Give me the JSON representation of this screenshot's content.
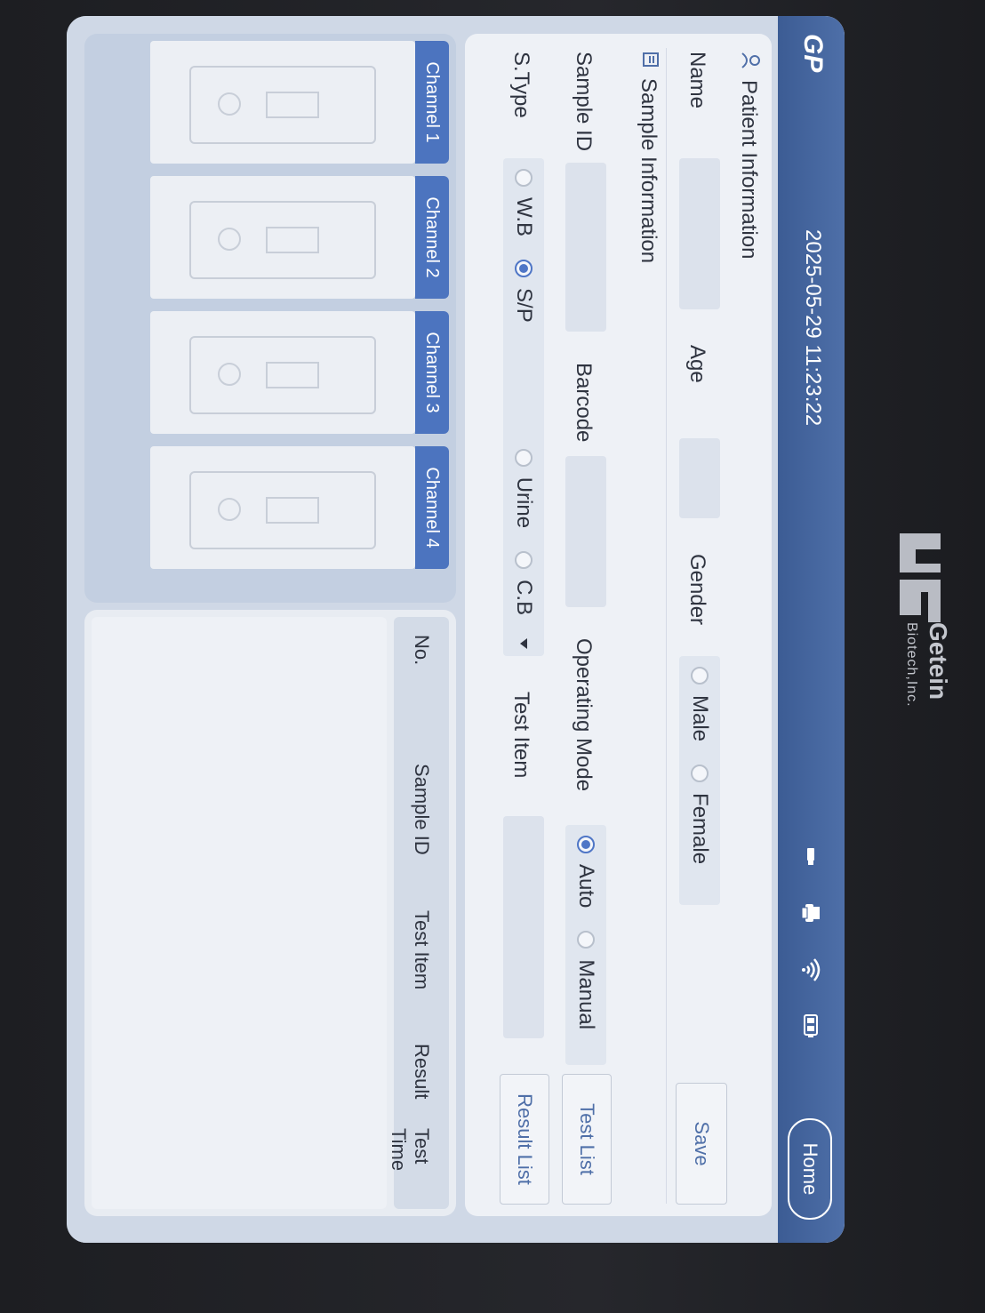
{
  "device": {
    "brand_name": "Getein",
    "brand_sub": "Biotech,Inc."
  },
  "topbar": {
    "logo": "GP",
    "datetime": "2025-05-29 11:23:22",
    "home_label": "Home",
    "icons": [
      "usb-icon",
      "printer-icon",
      "wifi-icon",
      "battery-icon"
    ]
  },
  "patient": {
    "section_title": "Patient Information",
    "name_label": "Name",
    "name_value": "",
    "age_label": "Age",
    "age_value": "",
    "gender_label": "Gender",
    "gender_options": [
      "Male",
      "Female"
    ],
    "gender_selected": "",
    "save_label": "Save"
  },
  "sample": {
    "section_title": "Sample Information",
    "sample_id_label": "Sample ID",
    "sample_id_value": "",
    "barcode_label": "Barcode",
    "barcode_value": "",
    "operating_mode_label": "Operating Mode",
    "mode_options": [
      "Auto",
      "Manual"
    ],
    "mode_selected": "Auto",
    "test_list_label": "Test List",
    "stype_label": "S.Type",
    "stype_options": [
      "W.B",
      "S/P",
      "Urine",
      "C.B"
    ],
    "stype_selected": "S/P",
    "test_item_label": "Test Item",
    "test_item_value": "",
    "result_list_label": "Result List"
  },
  "channels": [
    {
      "label": "Channel 1"
    },
    {
      "label": "Channel 2"
    },
    {
      "label": "Channel 3"
    },
    {
      "label": "Channel 4"
    }
  ],
  "results_table": {
    "columns": [
      "No.",
      "Sample ID",
      "Test Item",
      "Result",
      "Test Time"
    ],
    "rows": []
  },
  "colors": {
    "topbar": "#4e6fa8",
    "accent": "#4c74bf",
    "panel": "#eef1f6"
  }
}
